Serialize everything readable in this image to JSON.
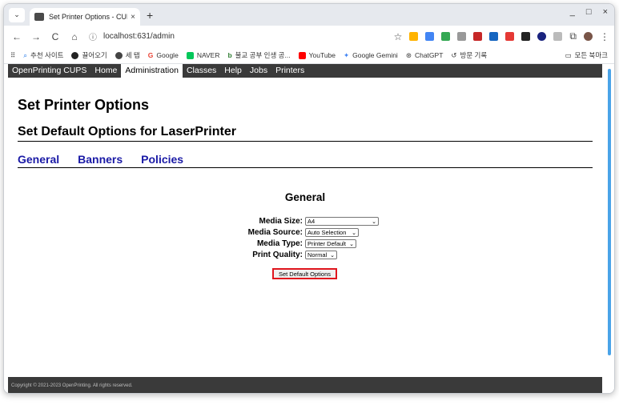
{
  "browser": {
    "tab_title": "Set Printer Options - CUPS",
    "tab_close": "×",
    "new_tab": "+",
    "window_controls": [
      "_",
      "□",
      "×"
    ],
    "url": "localhost:631/admin",
    "nav": [
      "←",
      "→",
      "C",
      "⌂"
    ]
  },
  "bookmarks": [
    "추천 사이트",
    "끌어오기",
    "세 탭",
    "Google",
    "NAVER",
    "불교 공부 인생 공...",
    "YouTube",
    "Google Gemini",
    "ChatGPT",
    "방문 기록"
  ],
  "bookmarks_right": "모든 북마크",
  "cups_nav": [
    "OpenPrinting CUPS",
    "Home",
    "Administration",
    "Classes",
    "Help",
    "Jobs",
    "Printers"
  ],
  "cups_nav_active": "Administration",
  "page": {
    "title": "Set Printer Options",
    "subtitle": "Set Default Options for LaserPrinter",
    "tabs": [
      "General",
      "Banners",
      "Policies"
    ],
    "section_title": "General",
    "fields": [
      {
        "label": "Media Size:",
        "value": "A4"
      },
      {
        "label": "Media Source:",
        "value": "Auto Selection"
      },
      {
        "label": "Media Type:",
        "value": "Printer Default"
      },
      {
        "label": "Print Quality:",
        "value": "Normal"
      }
    ],
    "submit_label": "Set Default Options",
    "footer": "Copyright © 2021-2023 OpenPrinting. All rights reserved."
  },
  "colors": {
    "nav_bg": "#3a3a3a",
    "link_blue": "#1a1aa6",
    "highlight_red": "#e0161e",
    "scroll_thumb": "#4aa3e8"
  }
}
